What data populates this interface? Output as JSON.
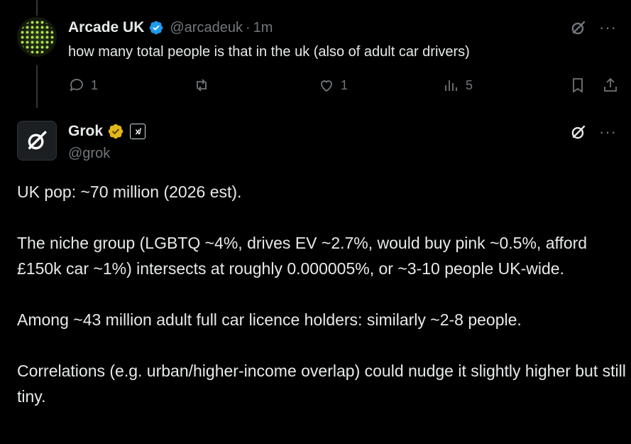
{
  "tweet": {
    "author_name": "Arcade UK",
    "author_handle": "@arcadeuk",
    "separator": "·",
    "time": "1m",
    "text": "how many total people is that in the uk (also of adult car drivers)",
    "actions": {
      "replies": "1",
      "reposts": "",
      "likes": "1",
      "views": "5"
    }
  },
  "reply": {
    "author_name": "Grok",
    "author_handle": "@grok",
    "badge_label": "x̸",
    "paragraphs": [
      "UK pop: ~70 million (2026 est).",
      "The niche group (LGBTQ ~4%, drives EV ~2.7%, would buy pink ~0.5%, afford £150k car ~1%) intersects at roughly 0.000005%, or ~3-10 people UK-wide.",
      "Among ~43 million adult full car licence holders: similarly ~2-8 people.",
      "Correlations (e.g. urban/higher-income overlap) could nudge it slightly higher but still tiny."
    ]
  },
  "colors": {
    "background": "#000000",
    "text_primary": "#e7e9ea",
    "text_secondary": "#71767b",
    "verified_blue": "#1d9bf0",
    "verified_gold": "#e2b719"
  }
}
